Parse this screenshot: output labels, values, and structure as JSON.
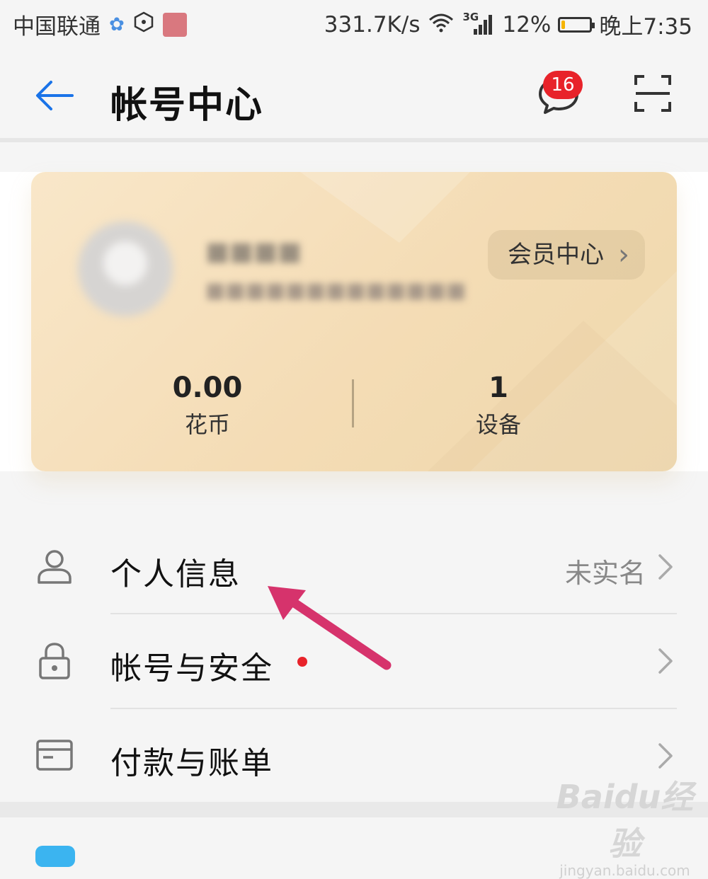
{
  "status_bar": {
    "carrier": "中国联通",
    "speed": "331.7K/s",
    "network": "3G",
    "battery_percent": "12%",
    "battery_level": 0.12,
    "time": "晚上7:35"
  },
  "header": {
    "title": "帐号中心",
    "message_badge": "16"
  },
  "card": {
    "member_center_label": "会员中心",
    "stats": [
      {
        "value": "0.00",
        "label": "花币"
      },
      {
        "value": "1",
        "label": "设备"
      }
    ]
  },
  "menu": {
    "items": [
      {
        "label": "个人信息",
        "status": "未实名",
        "icon": "person-icon"
      },
      {
        "label": "帐号与安全",
        "status": "",
        "icon": "lock-icon"
      },
      {
        "label": "付款与账单",
        "status": "",
        "icon": "card-icon"
      }
    ]
  },
  "watermark": {
    "logo": "Baidu经验",
    "url": "jingyan.baidu.com"
  },
  "colors": {
    "accent_blue": "#1a73e8",
    "badge_red": "#e8232a",
    "arrow_pink": "#d6336c",
    "card_gold": "#f4dcb5"
  }
}
